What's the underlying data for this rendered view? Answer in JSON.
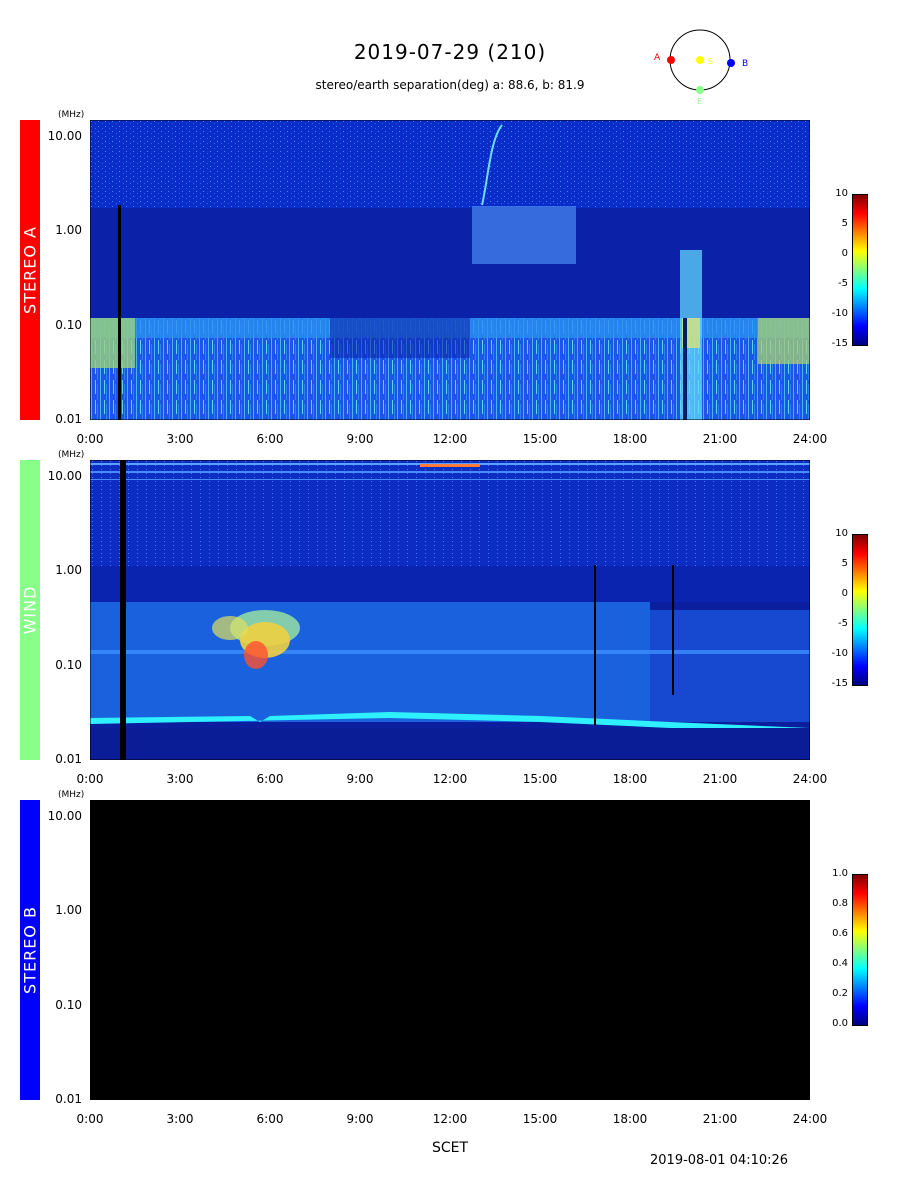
{
  "header": {
    "title": "2019-07-29 (210)",
    "subtitle": "stereo/earth separation(deg) a:  88.6, b:  81.9"
  },
  "orbit_diagram": {
    "labels": {
      "a": "A",
      "b": "B",
      "sun": "S",
      "earth": "E"
    },
    "colors": {
      "a": "#ff0000",
      "b": "#0000ff",
      "sun": "#ffff00",
      "earth": "#88ff88"
    }
  },
  "xlabel": "SCET",
  "timestamp": "2019-08-01 04:10:26",
  "chart_data": [
    {
      "type": "heatmap",
      "panel": "STEREO A",
      "label_color": "#ff0000",
      "y_unit": "(MHz)",
      "y_scale": "log",
      "ylim": [
        0.01,
        15
      ],
      "yticks": [
        "10.00",
        "1.00",
        "0.10",
        "0.01"
      ],
      "xticks": [
        "0:00",
        "3:00",
        "6:00",
        "9:00",
        "12:00",
        "15:00",
        "18:00",
        "21:00",
        "24:00"
      ],
      "xlim": [
        0,
        24
      ],
      "colorbar": {
        "ticks": [
          "10",
          "5",
          "0",
          "-5",
          "-10",
          "-15"
        ],
        "range": [
          -15,
          10
        ]
      }
    },
    {
      "type": "heatmap",
      "panel": "WIND",
      "label_color": "#88ff88",
      "y_unit": "(MHz)",
      "y_scale": "log",
      "ylim": [
        0.01,
        15
      ],
      "yticks": [
        "10.00",
        "1.00",
        "0.10",
        "0.01"
      ],
      "xticks": [
        "0:00",
        "3:00",
        "6:00",
        "9:00",
        "12:00",
        "15:00",
        "18:00",
        "21:00",
        "24:00"
      ],
      "xlim": [
        0,
        24
      ],
      "colorbar": {
        "ticks": [
          "10",
          "5",
          "0",
          "-5",
          "-10",
          "-15"
        ],
        "range": [
          -15,
          10
        ]
      }
    },
    {
      "type": "heatmap",
      "panel": "STEREO B",
      "label_color": "#0000ff",
      "y_unit": "(MHz)",
      "y_scale": "log",
      "ylim": [
        0.01,
        15
      ],
      "yticks": [
        "10.00",
        "1.00",
        "0.10",
        "0.01"
      ],
      "xticks": [
        "0:00",
        "3:00",
        "6:00",
        "9:00",
        "12:00",
        "15:00",
        "18:00",
        "21:00",
        "24:00"
      ],
      "xlim": [
        0,
        24
      ],
      "colorbar": {
        "ticks": [
          "1.0",
          "0.8",
          "0.6",
          "0.4",
          "0.2",
          "0.0"
        ],
        "range": [
          0,
          1
        ]
      }
    }
  ]
}
